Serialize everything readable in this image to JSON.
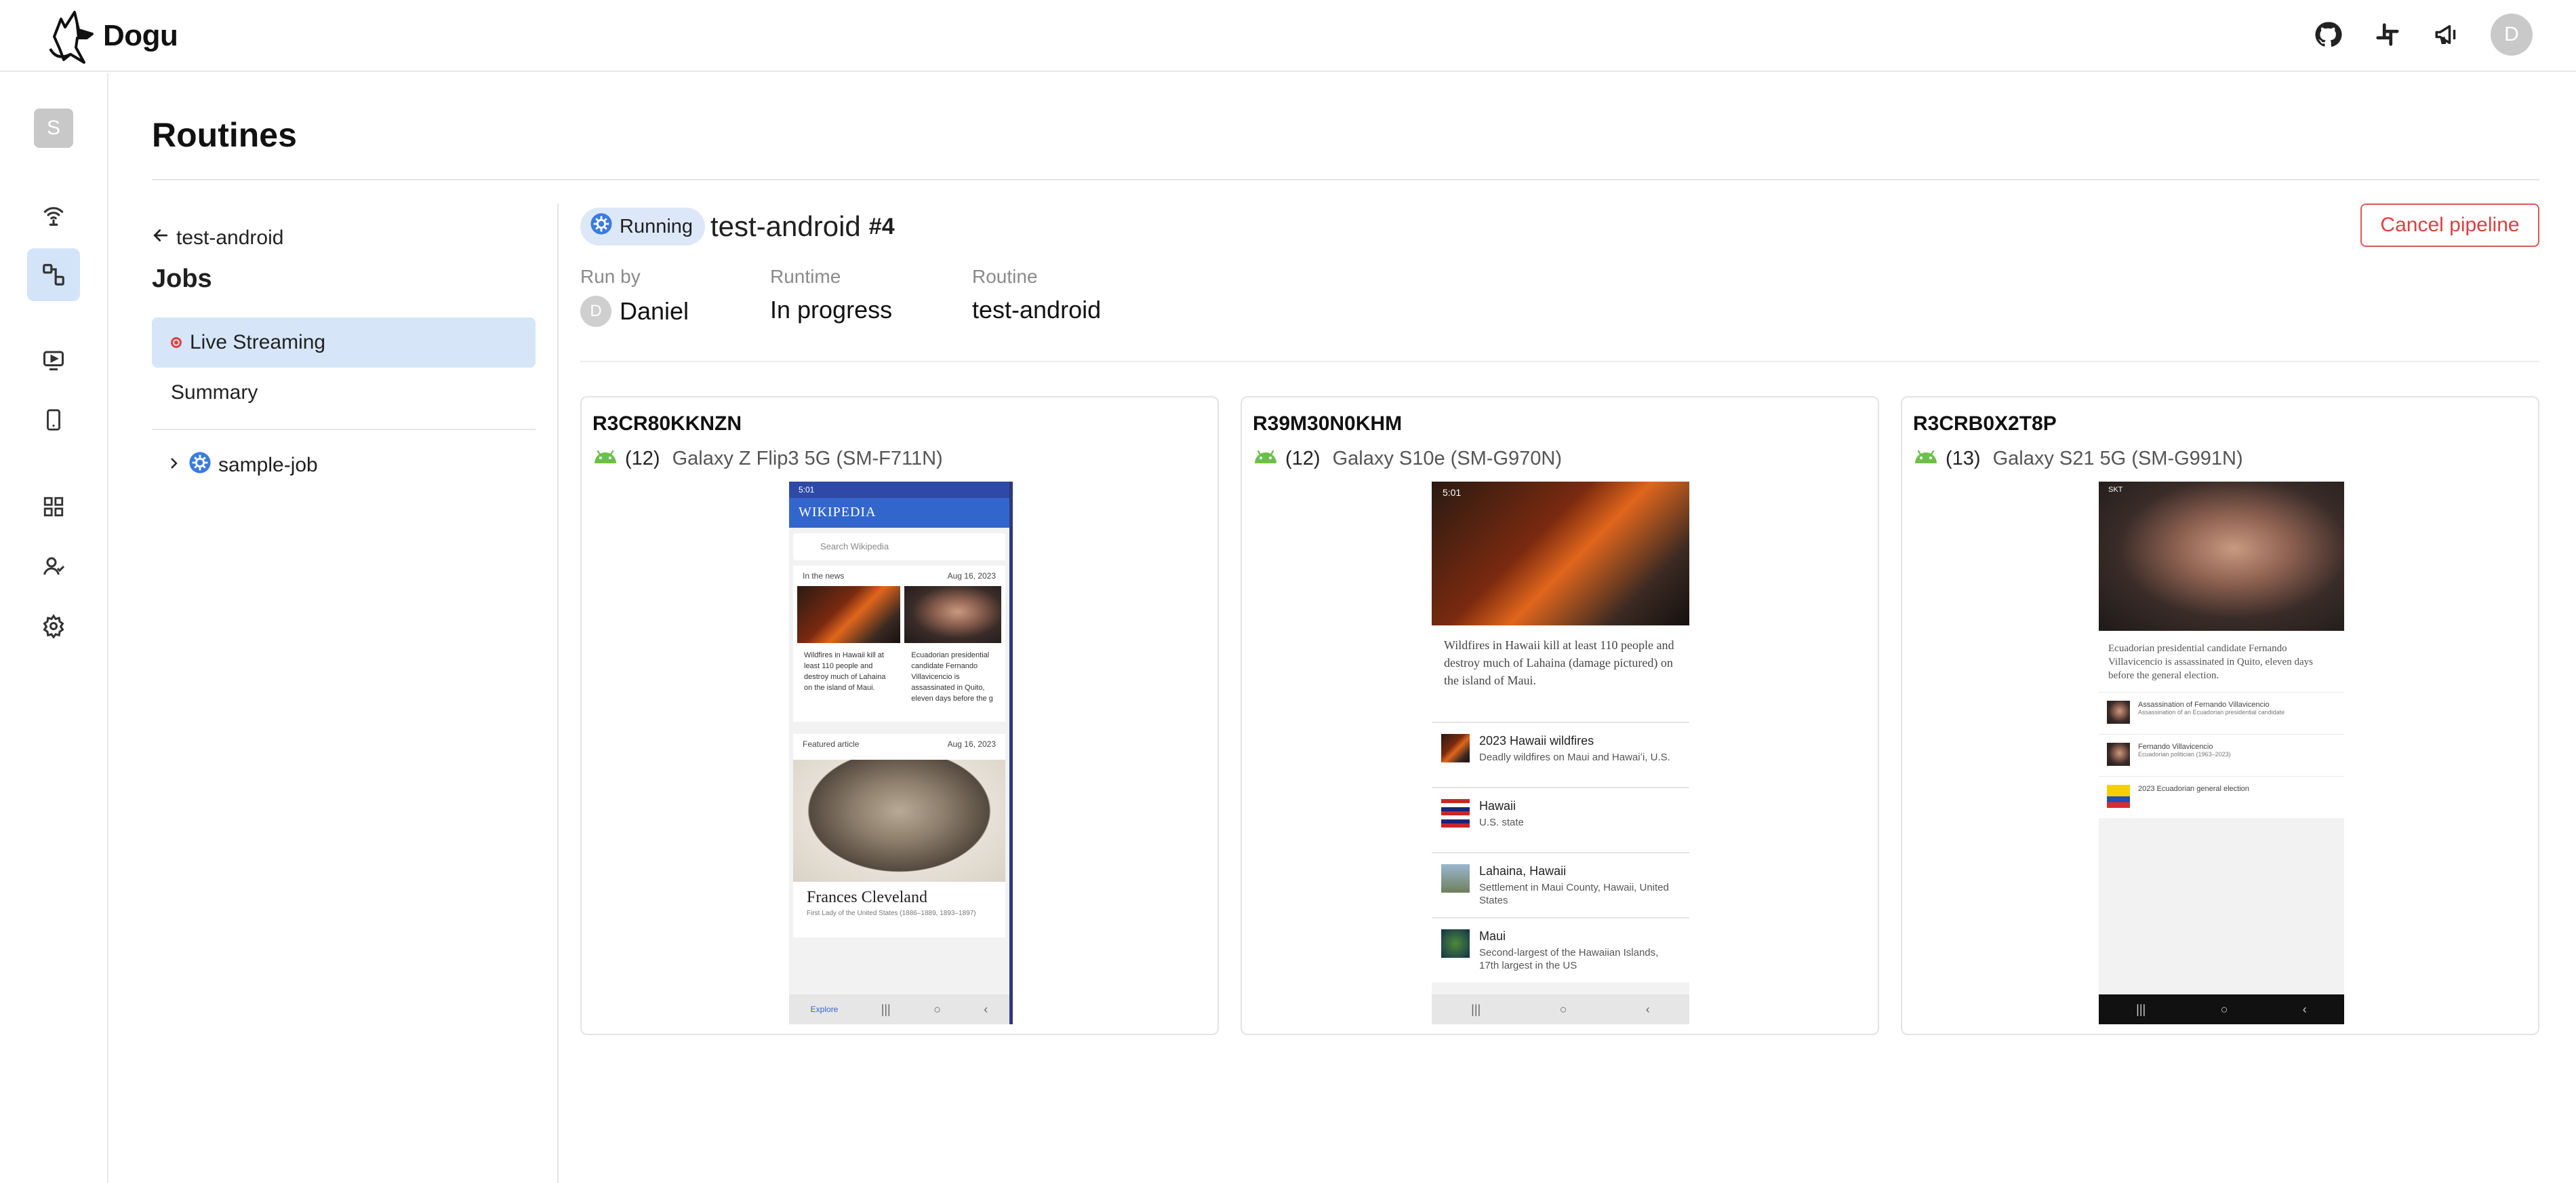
{
  "app": {
    "brand": "Dogu"
  },
  "header": {
    "icons": [
      "github-icon",
      "slack-icon",
      "megaphone-icon"
    ],
    "user_initial": "D"
  },
  "rail": {
    "org_initial": "S"
  },
  "page": {
    "title": "Routines"
  },
  "jobs_panel": {
    "back_label": "test-android",
    "title": "Jobs",
    "items": [
      {
        "label": "Live Streaming",
        "active": true
      },
      {
        "label": "Summary",
        "active": false
      }
    ],
    "tree": {
      "label": "sample-job",
      "expanded": false
    }
  },
  "pipeline": {
    "status": "Running",
    "name": "test-android",
    "number": "#4",
    "cancel_label": "Cancel pipeline",
    "meta": [
      {
        "label": "Run by",
        "value": "Daniel",
        "avatar": "D"
      },
      {
        "label": "Runtime",
        "value": "In progress"
      },
      {
        "label": "Routine",
        "value": "test-android"
      }
    ]
  },
  "devices": [
    {
      "serial": "R3CR80KKNZN",
      "api": "(12)",
      "model": "Galaxy Z Flip3 5G (SM-F711N)",
      "screen": {
        "status": "5:01",
        "app_title": "WIKIPEDIA",
        "search_placeholder": "Search Wikipedia",
        "news_header": "In the news",
        "news_date": "Aug 16, 2023",
        "news_text_1": "Wildfires in Hawaii kill at least 110 people and destroy much of Lahaina on the island of Maui.",
        "news_text_2": "Ecuadorian presidential candidate Fernando Villavicencio is assassinated in Quito, eleven days before the g",
        "featured_header": "Featured article",
        "featured_date": "Aug 16, 2023",
        "featured_title": "Frances Cleveland",
        "featured_sub": "First Lady of the United States (1886–1889, 1893–1897)",
        "nav_label": "Explore"
      }
    },
    {
      "serial": "R39M30N0KHM",
      "api": "(12)",
      "model": "Galaxy S10e (SM-G970N)",
      "screen": {
        "status": "5:01",
        "caption": "Wildfires in Hawaii kill at least 110 people and destroy much of Lahaina (damage pictured) on the island of Maui.",
        "rows": [
          {
            "title": "2023 Hawaii wildfires",
            "sub": "Deadly wildfires on Maui and Hawaiʻi, U.S."
          },
          {
            "title": "Hawaii",
            "sub": "U.S. state"
          },
          {
            "title": "Lahaina, Hawaii",
            "sub": "Settlement in Maui County, Hawaii, United States"
          },
          {
            "title": "Maui",
            "sub": "Second-largest of the Hawaiian Islands, 17th largest in the US"
          }
        ]
      }
    },
    {
      "serial": "R3CRB0X2T8P",
      "api": "(13)",
      "model": "Galaxy S21 5G (SM-G991N)",
      "screen": {
        "status": "SKT",
        "caption": "Ecuadorian presidential candidate Fernando Villavicencio is assassinated in Quito, eleven days before the general election.",
        "rows": [
          {
            "title": "Assassination of Fernando Villavicencio",
            "sub": "Assassination of an Ecuadorian presidential candidate"
          },
          {
            "title": "Fernando Villavicencio",
            "sub": "Ecuadorian politician (1963–2023)"
          },
          {
            "title": "2023 Ecuadorian general election",
            "sub": ""
          }
        ]
      }
    }
  ],
  "colors": {
    "accent": "#3b7be0",
    "active_bg": "#d6e6f8",
    "danger": "#d94141",
    "android": "#6cc04a"
  }
}
